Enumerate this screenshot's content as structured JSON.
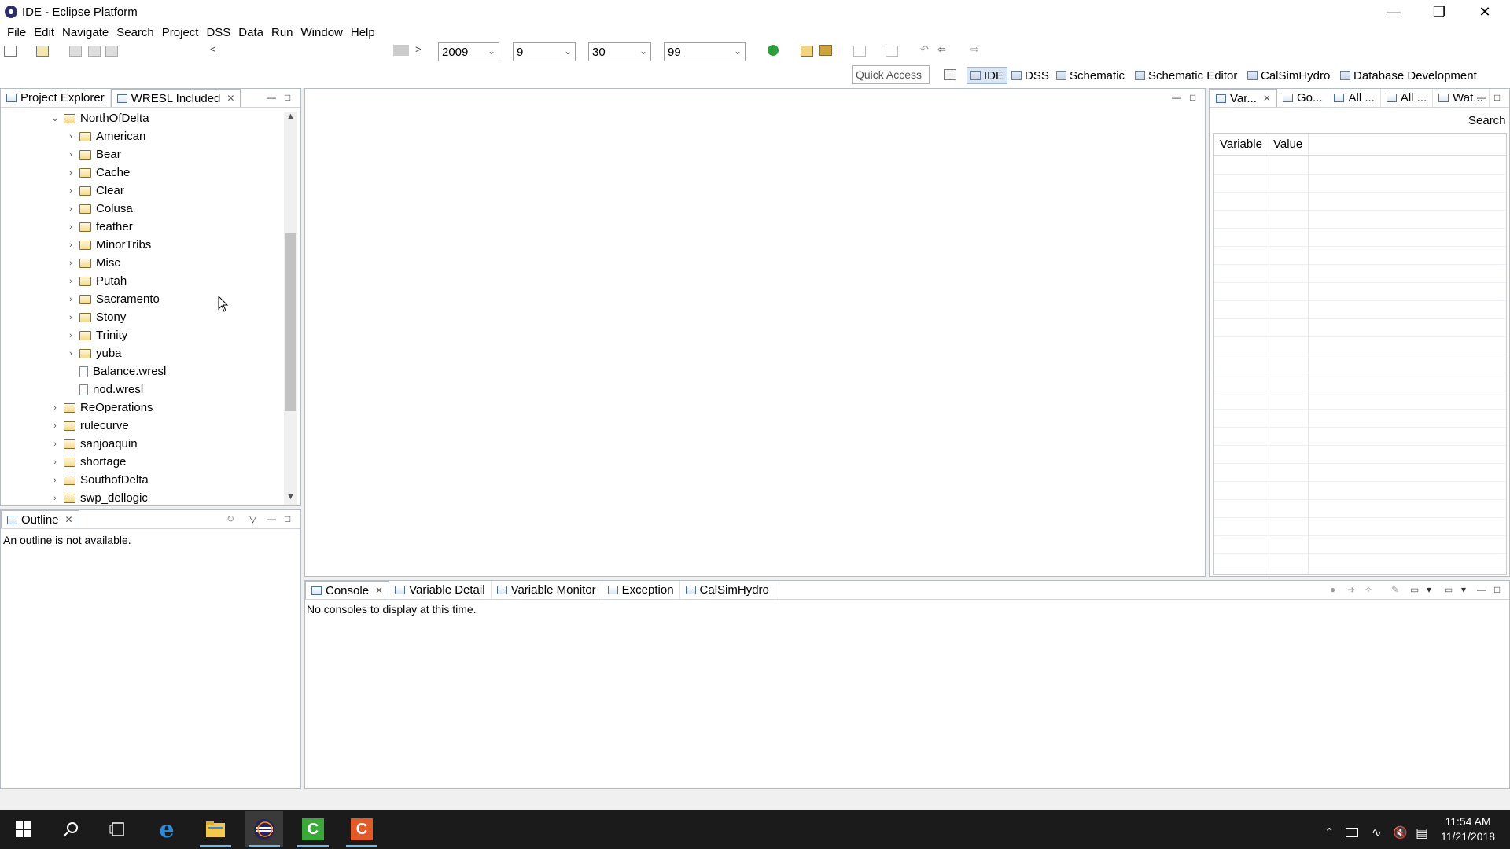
{
  "window": {
    "title": "IDE - Eclipse Platform"
  },
  "menu": [
    "File",
    "Edit",
    "Navigate",
    "Search",
    "Project",
    "DSS",
    "Data",
    "Run",
    "Window",
    "Help"
  ],
  "toolbar": {
    "combo_year": "2009",
    "combo_month": "9",
    "combo_day": "30",
    "combo_cycle": "99",
    "quick_access": "Quick Access"
  },
  "perspectives": [
    "IDE",
    "DSS",
    "Schematic",
    "Schematic Editor",
    "CalSimHydro",
    "Database Development"
  ],
  "left_panel": {
    "tabs": [
      "Project Explorer",
      "WRESL Included"
    ],
    "tree": [
      {
        "label": "NorthOfDelta",
        "indent": 1,
        "type": "folder",
        "expanded": true
      },
      {
        "label": "American",
        "indent": 2,
        "type": "folder"
      },
      {
        "label": "Bear",
        "indent": 2,
        "type": "folder"
      },
      {
        "label": "Cache",
        "indent": 2,
        "type": "folder"
      },
      {
        "label": "Clear",
        "indent": 2,
        "type": "folder"
      },
      {
        "label": "Colusa",
        "indent": 2,
        "type": "folder"
      },
      {
        "label": "feather",
        "indent": 2,
        "type": "folder"
      },
      {
        "label": "MinorTribs",
        "indent": 2,
        "type": "folder"
      },
      {
        "label": "Misc",
        "indent": 2,
        "type": "folder"
      },
      {
        "label": "Putah",
        "indent": 2,
        "type": "folder"
      },
      {
        "label": "Sacramento",
        "indent": 2,
        "type": "folder"
      },
      {
        "label": "Stony",
        "indent": 2,
        "type": "folder"
      },
      {
        "label": "Trinity",
        "indent": 2,
        "type": "folder"
      },
      {
        "label": "yuba",
        "indent": 2,
        "type": "folder"
      },
      {
        "label": "Balance.wresl",
        "indent": 2,
        "type": "file"
      },
      {
        "label": "nod.wresl",
        "indent": 2,
        "type": "file"
      },
      {
        "label": "ReOperations",
        "indent": 1,
        "type": "folder"
      },
      {
        "label": "rulecurve",
        "indent": 1,
        "type": "folder"
      },
      {
        "label": "sanjoaquin",
        "indent": 1,
        "type": "folder"
      },
      {
        "label": "shortage",
        "indent": 1,
        "type": "folder"
      },
      {
        "label": "SouthofDelta",
        "indent": 1,
        "type": "folder"
      },
      {
        "label": "swp_dellogic",
        "indent": 1,
        "type": "folder"
      }
    ]
  },
  "outline": {
    "tab": "Outline",
    "message": "An outline is not available."
  },
  "right_panel": {
    "tabs": [
      "Var...",
      "Go...",
      "All ...",
      "All ...",
      "Wat..."
    ],
    "search_label": "Search",
    "columns": [
      "Variable",
      "Value"
    ]
  },
  "console": {
    "tabs": [
      "Console",
      "Variable Detail",
      "Variable Monitor",
      "Exception",
      "CalSimHydro"
    ],
    "message": "No consoles to display at this time."
  },
  "taskbar": {
    "time": "11:54 AM",
    "date": "11/21/2018"
  }
}
